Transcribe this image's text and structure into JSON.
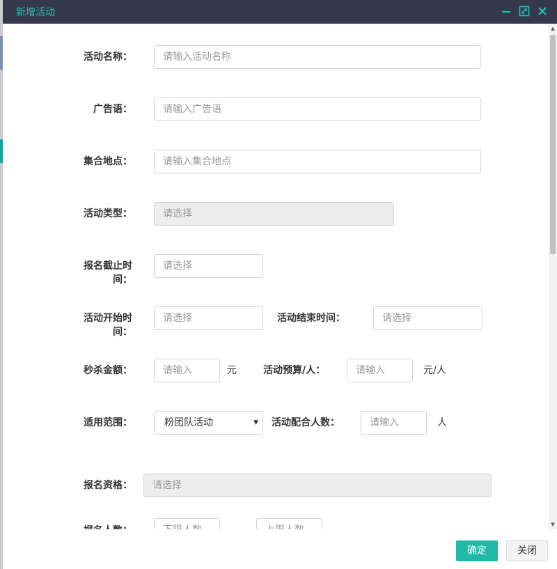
{
  "dialog": {
    "title": "新增活动",
    "minimize_icon": "minimize-icon",
    "maximize_icon": "maximize-icon",
    "close_icon": "close-icon",
    "title_color": "#1fc1b3",
    "titlebar_bg": "#343a4c"
  },
  "form": {
    "activity_name": {
      "label": "活动名称：",
      "placeholder": "请输入活动名称"
    },
    "slogan": {
      "label": "广告语：",
      "placeholder": "请输入广告语"
    },
    "meeting_place": {
      "label": "集合地点：",
      "placeholder": "请输入集合地点"
    },
    "activity_type": {
      "label": "活动类型：",
      "placeholder": "请选择"
    },
    "signup_deadline": {
      "label_line1": "报名截止时",
      "label_line2": "间：",
      "placeholder": "请选择"
    },
    "start_time": {
      "label_line1": "活动开始时",
      "label_line2": "间：",
      "placeholder": "请选择"
    },
    "end_time": {
      "label": "活动结束时间：",
      "placeholder": "请选择"
    },
    "flash_price": {
      "label": "秒杀金额：",
      "placeholder": "请输入",
      "unit": "元"
    },
    "budget_per_person": {
      "label": "活动预算/人：",
      "placeholder": "请输入",
      "unit": "元/人"
    },
    "scope": {
      "label": "适用范围：",
      "selected": "粉团队活动"
    },
    "participant_count": {
      "label": "活动配合人数：",
      "placeholder": "请输入",
      "unit": "人"
    },
    "qualification": {
      "label": "报名资格：",
      "placeholder": "请选择"
    },
    "signup_count": {
      "label": "报名人数：",
      "min_placeholder": "下限人数",
      "max_placeholder": "上限人数"
    }
  },
  "footer": {
    "confirm_label": "确定",
    "close_label": "关闭",
    "accent_color": "#20b9a8"
  }
}
